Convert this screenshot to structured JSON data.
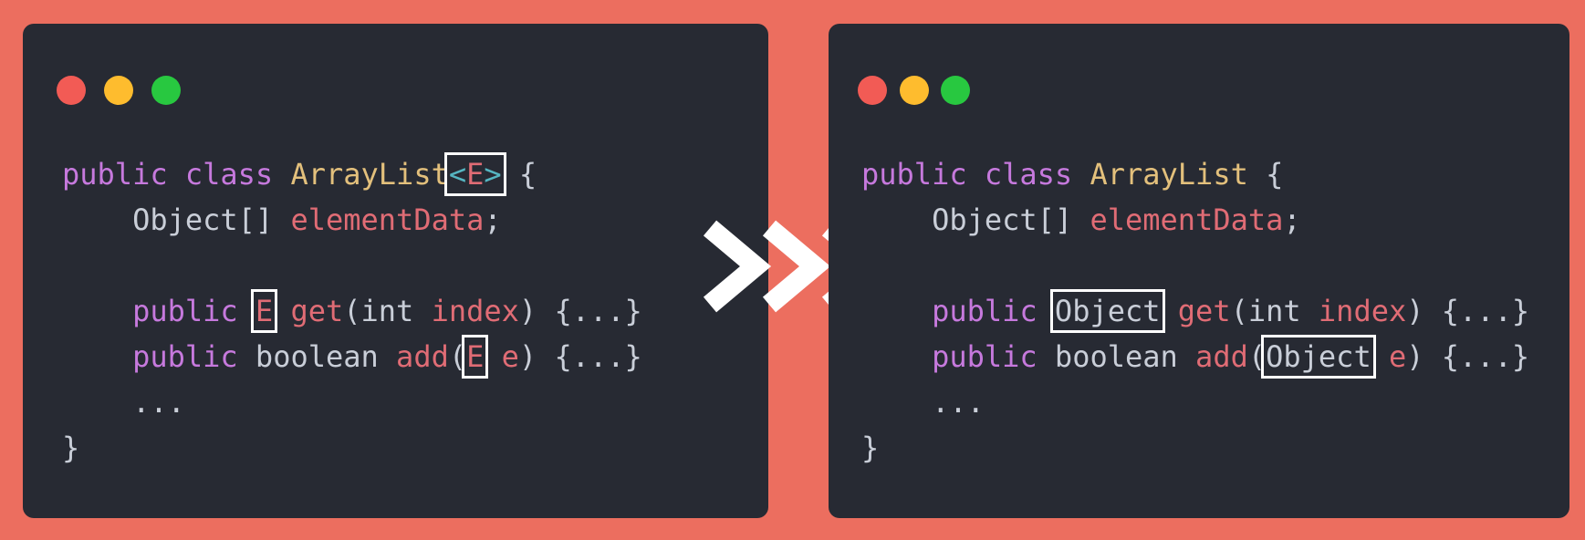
{
  "colors": {
    "background": "#ec6e5f",
    "panel": "#272a33",
    "keyword": "#c679dd",
    "class_name": "#e3c07c",
    "field": "#e06c75",
    "plain": "#c9ced8",
    "angle_bracket": "#56b6c2",
    "highlight_box": "#ffffff",
    "dot_red": "#f25b55",
    "dot_yellow": "#febc2e",
    "dot_green": "#28c840"
  },
  "arrow_icon": "triple-chevron-right-icon",
  "left": {
    "line1": {
      "kw1": "public",
      "kw2": "class",
      "cls": "ArrayList",
      "lt": "<",
      "tparam": "E",
      "gt": ">",
      "brace": "{"
    },
    "line2": {
      "type": "Object[]",
      "field": "elementData",
      "semi": ";"
    },
    "line4": {
      "kw": "public",
      "ret": "E",
      "fn": "get",
      "open": "(",
      "ptype": "int",
      "pname": "index",
      "rest": ") {...}"
    },
    "line5": {
      "kw": "public",
      "ret": "boolean",
      "fn": "add",
      "open": "(",
      "ptype": "E",
      "pname": "e",
      "rest": ") {...}"
    },
    "line6": {
      "ellipsis": "..."
    },
    "line7": {
      "brace": "}"
    }
  },
  "right": {
    "line1": {
      "kw1": "public",
      "kw2": "class",
      "cls": "ArrayList",
      "brace": "{"
    },
    "line2": {
      "type": "Object[]",
      "field": "elementData",
      "semi": ";"
    },
    "line4": {
      "kw": "public",
      "ret": "Object",
      "fn": "get",
      "open": "(",
      "ptype": "int",
      "pname": "index",
      "rest": ") {...}"
    },
    "line5": {
      "kw": "public",
      "ret": "boolean",
      "fn": "add",
      "open": "(",
      "ptype": "Object",
      "pname": "e",
      "rest": ") {...}"
    },
    "line6": {
      "ellipsis": "..."
    },
    "line7": {
      "brace": "}"
    }
  }
}
